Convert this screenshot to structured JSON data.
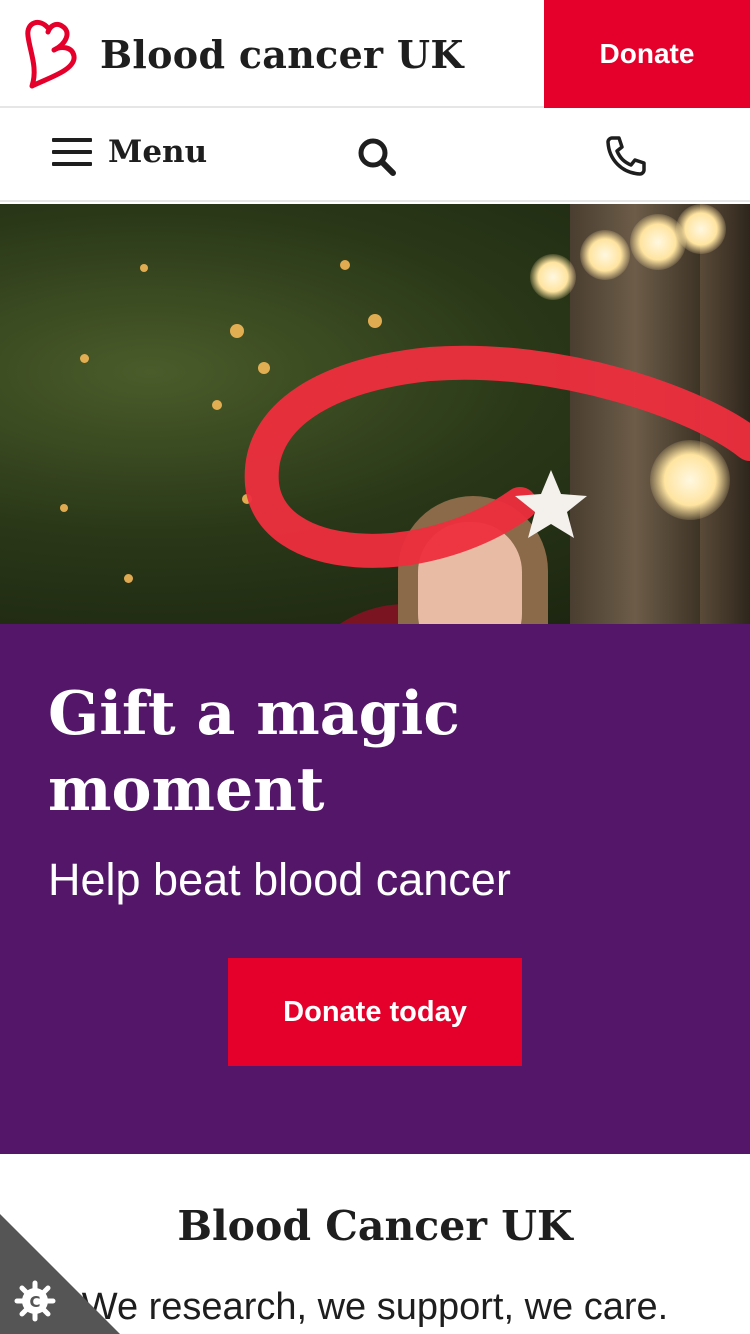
{
  "header": {
    "brand_name": "Blood cancer UK",
    "donate_label": "Donate"
  },
  "nav": {
    "menu_label": "Menu"
  },
  "promo": {
    "title": "Gift a magic moment",
    "subtitle": "Help beat blood cancer",
    "cta_label": "Donate today"
  },
  "intro": {
    "title": "Blood Cancer UK",
    "text": "We research, we support, we care."
  },
  "colors": {
    "brand_red": "#e4002b",
    "promo_purple": "#531669",
    "text_dark": "#1e1e1e"
  },
  "icons": [
    "logo-heart-b-icon",
    "hamburger-icon",
    "search-icon",
    "phone-icon",
    "cookie-settings-icon"
  ]
}
